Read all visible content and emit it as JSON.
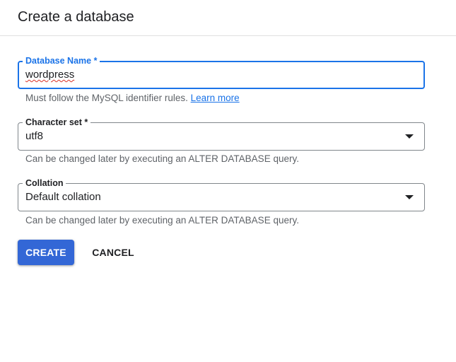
{
  "dialog": {
    "title": "Create a database"
  },
  "fields": {
    "database_name": {
      "label": "Database Name *",
      "value": "wordpress",
      "hint_text": "Must follow the MySQL identifier rules.",
      "hint_link": "Learn more"
    },
    "character_set": {
      "label": "Character set *",
      "value": "utf8",
      "hint_text": "Can be changed later by executing an ALTER DATABASE query."
    },
    "collation": {
      "label": "Collation",
      "value": "Default collation",
      "hint_text": "Can be changed later by executing an ALTER DATABASE query."
    }
  },
  "actions": {
    "create_label": "CREATE",
    "cancel_label": "CANCEL"
  },
  "colors": {
    "accent": "#1a73e8",
    "primary_button": "#3367d6",
    "hint_text": "#5f6368",
    "border": "#80868b",
    "spellcheck_underline": "#d93025"
  },
  "icons": {
    "dropdown": "arrow-drop-down-icon"
  }
}
